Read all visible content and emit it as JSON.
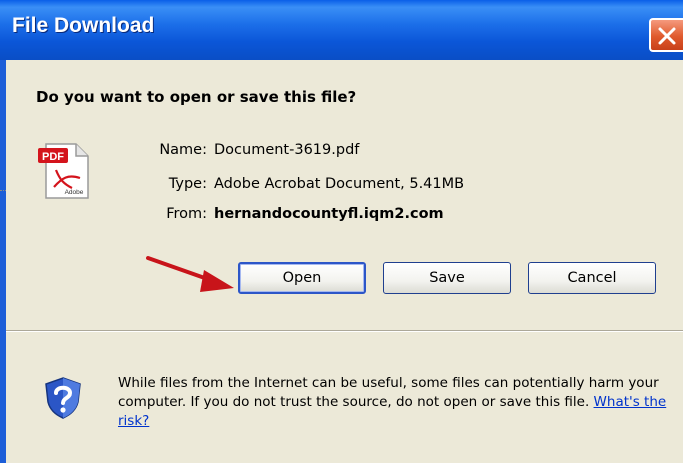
{
  "window": {
    "title": "File Download"
  },
  "dialog": {
    "question": "Do you want to open or save this file?",
    "file": {
      "name_label": "Name:",
      "name_value": "Document-3619.pdf",
      "type_label": "Type:",
      "type_value": "Adobe Acrobat Document, 5.41MB",
      "from_label": "From:",
      "from_value": "hernandocountyfl.iqm2.com",
      "icon": "pdf-file-icon",
      "icon_badge": "PDF",
      "icon_caption": "Adobe"
    },
    "buttons": {
      "open": "Open",
      "save": "Save",
      "cancel": "Cancel"
    },
    "warning": {
      "text": "While files from the Internet can be useful, some files can potentially harm your computer. If you do not trust the source, do not open or save this file.",
      "link": "What's the risk?"
    }
  },
  "colors": {
    "titlebar": "#0a56d8",
    "close": "#e05a2d",
    "arrow": "#c8141a",
    "link": "#0033cc"
  }
}
